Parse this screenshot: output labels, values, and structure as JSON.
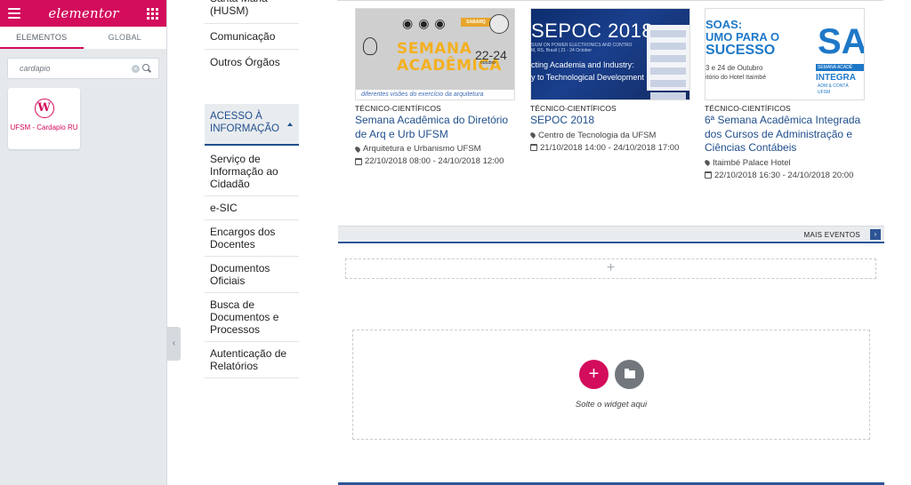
{
  "panel": {
    "logo": "elementor",
    "tabs": [
      "ELEMENTOS",
      "GLOBAL"
    ],
    "search_value": "cardapio",
    "widget_label": "UFSM - Cardapio RU"
  },
  "side_menu": {
    "items": [
      "Santa Maria (HUSM)",
      "Comunicação",
      "Outros Órgãos"
    ],
    "section_title": "ACESSO À INFORMAÇÃO",
    "sub_items": [
      "Serviço de Informação ao Cidadão",
      "e-SIC",
      "Encargos dos Docentes",
      "Documentos Oficiais",
      "Busca de Documentos e Processos",
      "Autenticação de Relatórios"
    ]
  },
  "events": [
    {
      "category": "TÉCNICO-CIENTÍFICOS",
      "title": "Semana Acadêmica do Diretório de Arq e Urb UFSM",
      "place": "Arquitetura e Urbanismo UFSM",
      "date": "22/10/2018 08:00 - 24/10/2018 12:00",
      "thumb": {
        "badge": "SABARQ",
        "line1": "SEMANA",
        "line2": "ACADÊMICA",
        "dates": "22-24",
        "month": "outubro",
        "band": "diferentes visões do exercício da arquitetura"
      }
    },
    {
      "category": "TÉCNICO-CIENTÍFICOS",
      "title": "SEPOC 2018",
      "place": "Centro de Tecnologia da UFSM",
      "date": "21/10/2018 14:00 - 24/10/2018 17:00",
      "thumb": {
        "title": "SEPOC 2018",
        "small": "SIUM ON POWER ELECTRONICS AND CONTRO",
        "small2": "M, RS, Brasil | 21 - 24 October",
        "line1": "cting Academia and Industry:",
        "line2": "y to Technological Development"
      }
    },
    {
      "category": "TÉCNICO-CIENTÍFICOS",
      "title": "6ª Semana Acadêmica Integrada dos Cursos de Administração e Ciências Contábeis",
      "place": "Itaimbé Palace Hotel",
      "date": "22/10/2018 16:30 - 24/10/2018 20:00",
      "thumb": {
        "l1": "SOAS:",
        "l2": "UMO PARA O",
        "l3": "SUCESSO",
        "l4": "3 e 24 de Outubro",
        "l5": "itório do Hotel Itaimbé",
        "mark": "SA",
        "sub1": "SEMANA ACADÊ",
        "sub2": "INTEGRA",
        "sub3": "ADM & CONTÁ",
        "sub4": "UFSM"
      }
    }
  ],
  "more_events_label": "MAIS EVENTOS",
  "add_section_glyph": "+",
  "drop_text": "Solte o widget aqui",
  "colors": {
    "elementor_pink": "#d30c5c",
    "ufsm_blue": "#1f4e8c"
  }
}
